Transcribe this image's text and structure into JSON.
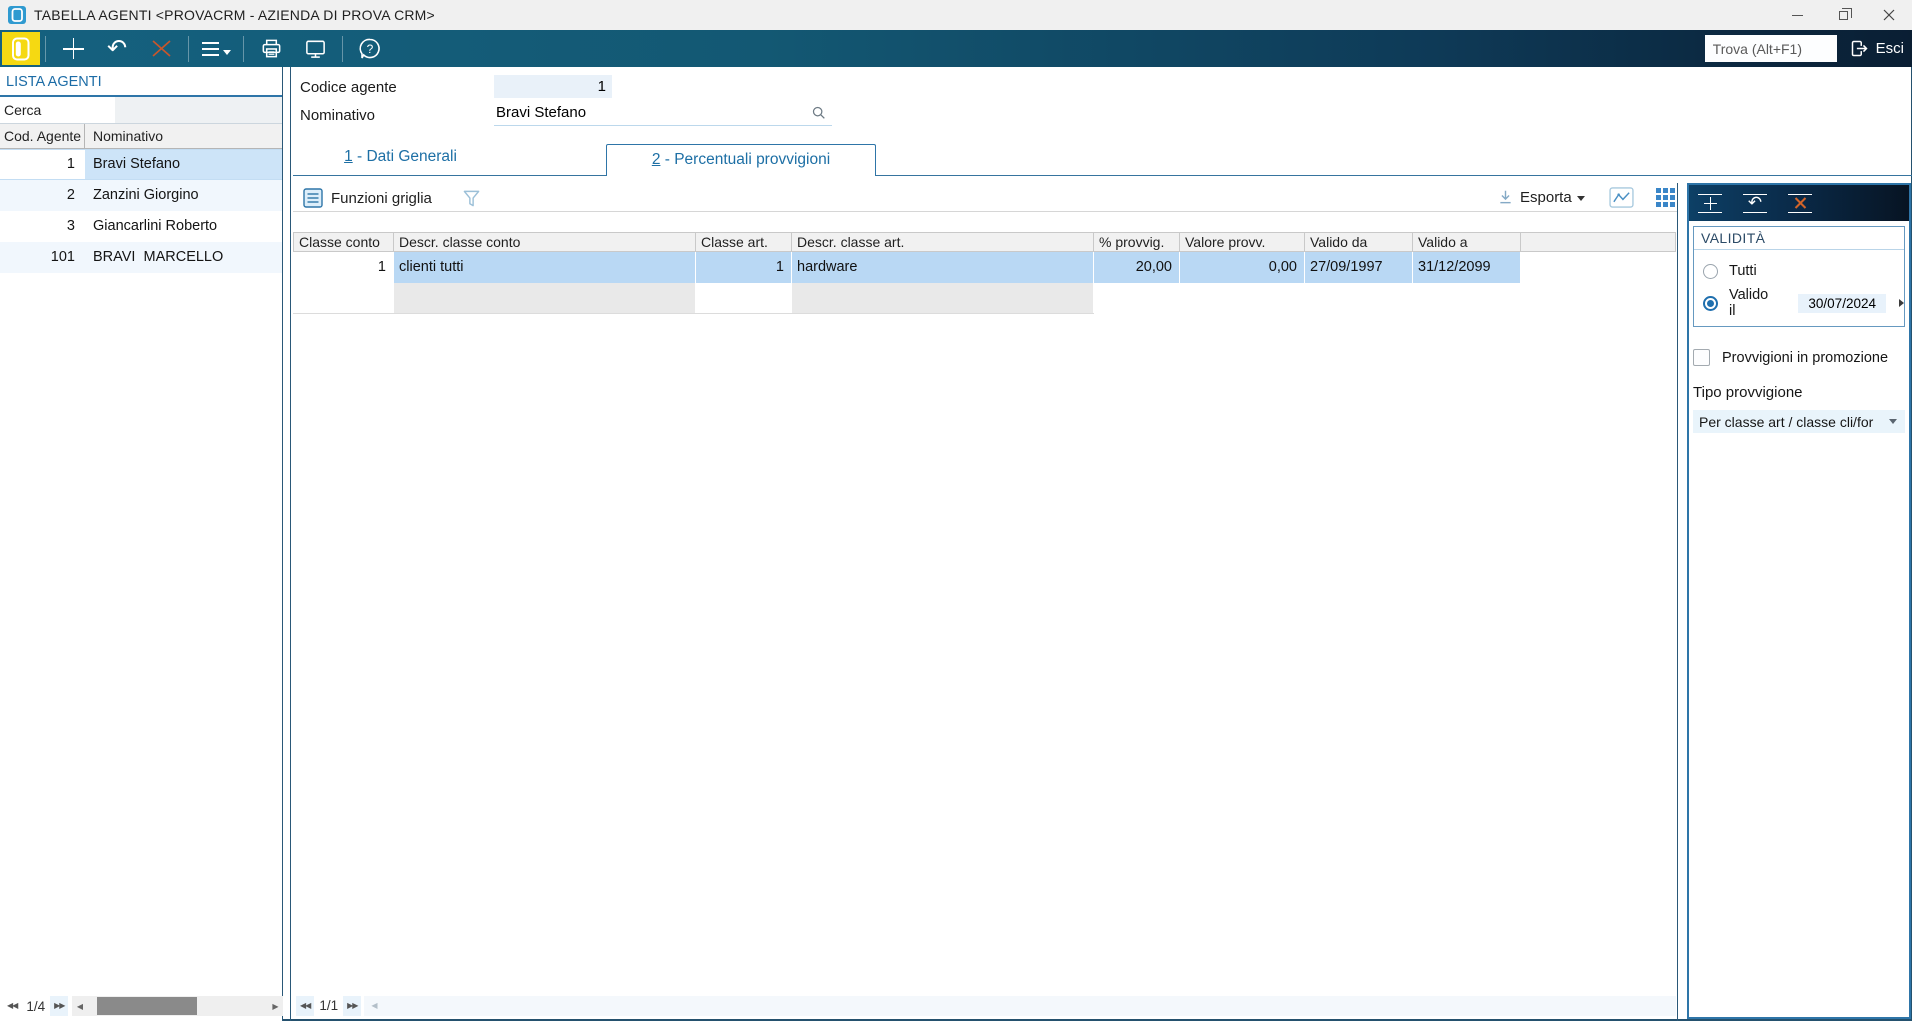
{
  "colors": {
    "accent_blue": "#2e75a8",
    "link_blue": "#1d6fa5",
    "toolbar_gradient": [
      "#15617f",
      "#0a1e33"
    ],
    "panel_toolbar_gradient": [
      "#0d4066",
      "#071423"
    ],
    "yellow_button": "#f5d912",
    "delete_orange": "#c8562b",
    "grid_selection": "#b9d8f4",
    "sidebar_selection": "#cde4f8",
    "header_gray": "#f1f1f1"
  },
  "icons": {
    "new": "+",
    "undo": "↶",
    "delete": "×",
    "menu": "≡",
    "print": "printer",
    "preview": "monitor",
    "help": "?",
    "exit": "door-arrow",
    "search": "magnifier",
    "filter": "funnel",
    "export": "download-arrow",
    "chart": "line-chart",
    "layout": "grid-squares",
    "first": "◀◀",
    "prev": "◀",
    "next": "▶▶",
    "caret_down": "▾"
  },
  "title_bar": {
    "title": "TABELLA AGENTI <PROVACRM - AZIENDA DI PROVA CRM>"
  },
  "toolbar": {
    "trova_placeholder": "Trova (Alt+F1)",
    "esci_label": "Esci"
  },
  "sidebar": {
    "header": "LISTA AGENTI",
    "search_label": "Cerca",
    "columns": [
      "Cod. Agente",
      "Nominativo"
    ],
    "rows": [
      {
        "code": "1",
        "name": "Bravi Stefano"
      },
      {
        "code": "2",
        "name": "Zanzini Giorgino"
      },
      {
        "code": "3",
        "name": "Giancarlini Roberto"
      },
      {
        "code": "101",
        "name": "BRAVI  MARCELLO"
      }
    ],
    "pagination": "1/4"
  },
  "form": {
    "codice_label": "Codice agente",
    "codice_value": "1",
    "nominativo_label": "Nominativo",
    "nominativo_value": "Bravi Stefano"
  },
  "tabs": [
    {
      "num": "1",
      "rest": " - Dati Generali"
    },
    {
      "num": "2",
      "rest": " - Percentuali provvigioni"
    }
  ],
  "grid": {
    "funzioni_label": "Funzioni griglia",
    "esporta_label": "Esporta",
    "columns": [
      "Classe conto",
      "Descr. classe conto",
      "Classe art.",
      "Descr. classe art.",
      "% provvig.",
      "Valore provv.",
      "Valido da",
      "Valido a"
    ],
    "row": [
      "1",
      "clienti tutti",
      "1",
      "hardware",
      "20,00",
      "0,00",
      "27/09/1997",
      "31/12/2099"
    ],
    "pagination": "1/1"
  },
  "panel": {
    "validita_title": "VALIDITÀ",
    "radio_tutti": "Tutti",
    "radio_valido": "Valido il",
    "valido_date": "30/07/2024",
    "checkbox_label": "Provvigioni in promozione",
    "tipo_label": "Tipo provvigione",
    "tipo_value": "Per classe art / classe cli/for"
  }
}
